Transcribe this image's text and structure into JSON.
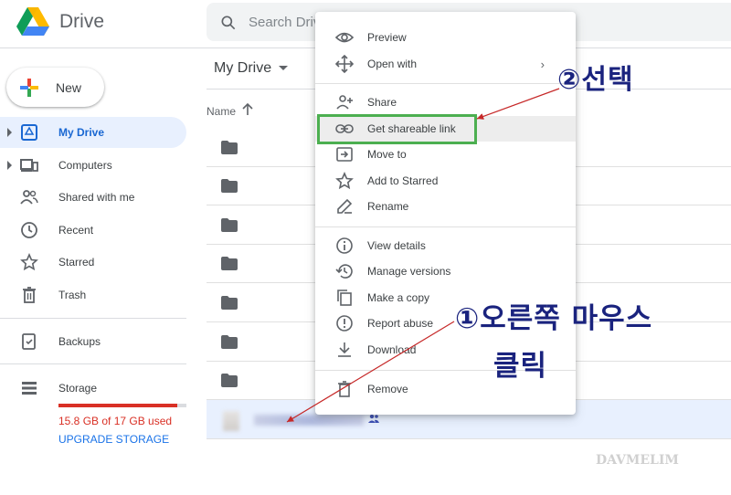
{
  "app": {
    "title": "Drive"
  },
  "search": {
    "placeholder": "Search Drive"
  },
  "sidebar": {
    "new_label": "New",
    "items": [
      {
        "label": "My Drive",
        "icon": "my-drive-icon"
      },
      {
        "label": "Computers",
        "icon": "computer-icon"
      },
      {
        "label": "Shared with me",
        "icon": "people-icon"
      },
      {
        "label": "Recent",
        "icon": "clock-icon"
      },
      {
        "label": "Starred",
        "icon": "star-icon"
      },
      {
        "label": "Trash",
        "icon": "trash-icon"
      },
      {
        "label": "Backups",
        "icon": "backup-icon"
      },
      {
        "label": "Storage",
        "icon": "storage-icon"
      }
    ],
    "storage": {
      "used_text": "15.8 GB of 17 GB used",
      "used_fraction": 0.93,
      "upgrade_label": "UPGRADE STORAGE"
    }
  },
  "main": {
    "breadcrumb": "My Drive",
    "column_name": "Name"
  },
  "context_menu": {
    "items": [
      {
        "label": "Preview",
        "icon": "eye-icon"
      },
      {
        "label": "Open with",
        "icon": "move-icon",
        "submenu": "›"
      },
      {
        "label": "Share",
        "icon": "add-person-icon"
      },
      {
        "label": "Get shareable link",
        "icon": "link-icon",
        "highlighted": true
      },
      {
        "label": "Move to",
        "icon": "move-to-icon"
      },
      {
        "label": "Add to Starred",
        "icon": "star-outline-icon"
      },
      {
        "label": "Rename",
        "icon": "pencil-icon"
      },
      {
        "label": "View details",
        "icon": "info-icon"
      },
      {
        "label": "Manage versions",
        "icon": "history-icon"
      },
      {
        "label": "Make a copy",
        "icon": "copy-icon"
      },
      {
        "label": "Report abuse",
        "icon": "alert-icon"
      },
      {
        "label": "Download",
        "icon": "download-icon"
      },
      {
        "label": "Remove",
        "icon": "trash-icon"
      }
    ]
  },
  "annotations": {
    "step2": "②선택",
    "step1_line1": "①오른쪽 마우스",
    "step1_line2": "클릭",
    "watermark": "DAVMELIM"
  },
  "colors": {
    "accent": "#1a73e8",
    "active_bg": "#e8f0fe",
    "highlight_box": "#4caf50",
    "annotation": "#1a237e",
    "warning": "#d93025"
  }
}
